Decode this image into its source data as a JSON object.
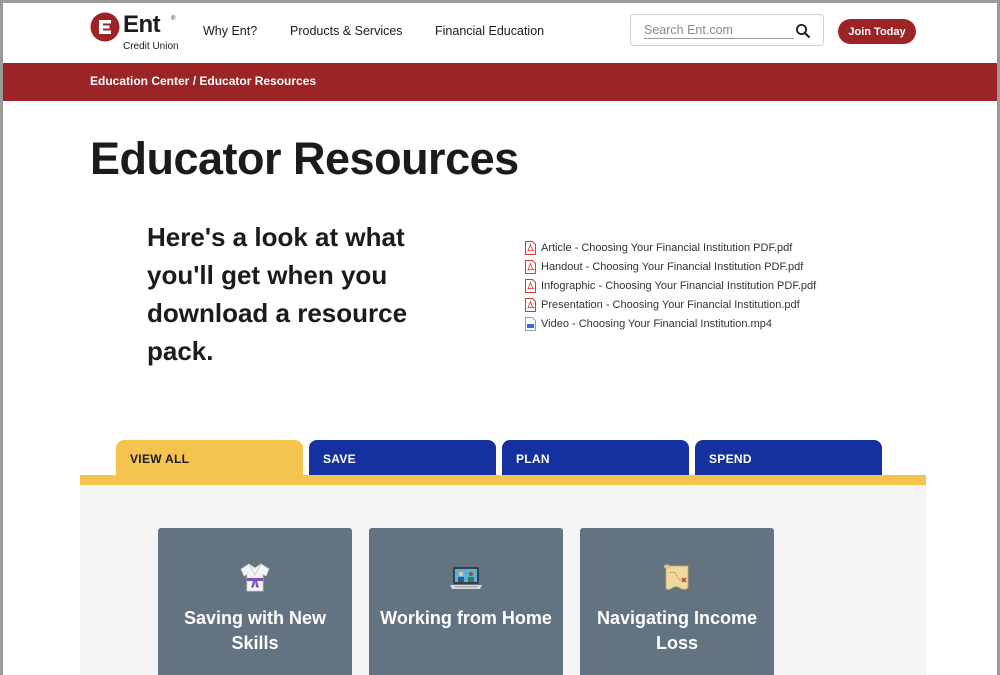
{
  "header": {
    "logo": {
      "word": "Ent",
      "tm": "®",
      "subtitle": "Credit Union"
    },
    "nav": [
      "Why Ent?",
      "Products & Services",
      "Financial Education"
    ],
    "search_placeholder": "Search Ent.com",
    "join_label": "Join Today"
  },
  "breadcrumb": {
    "section": "Education Center",
    "separator": " / ",
    "current": "Educator Resources"
  },
  "page_title": "Educator Resources",
  "lead": "Here's a look at what you'll get when you download a resource pack.",
  "files": [
    {
      "label": "Article - Choosing Your Financial Institution PDF.pdf",
      "icon": "pdf-file-icon"
    },
    {
      "label": "Handout - Choosing Your Financial Institution PDF.pdf",
      "icon": "pdf-file-icon"
    },
    {
      "label": "Infographic - Choosing Your Financial Institution PDF.pdf",
      "icon": "pdf-file-icon"
    },
    {
      "label": "Presentation - Choosing Your Financial Institution.pdf",
      "icon": "pdf-file-icon"
    },
    {
      "label": "Video - Choosing Your Financial Institution.mp4",
      "icon": "video-file-icon"
    }
  ],
  "tabs": [
    {
      "label": "VIEW ALL",
      "active": true
    },
    {
      "label": "SAVE",
      "active": false
    },
    {
      "label": "PLAN",
      "active": false
    },
    {
      "label": "SPEND",
      "active": false
    }
  ],
  "cards": [
    {
      "title": "Saving with New Skills",
      "icon": "karate-uniform-icon"
    },
    {
      "title": "Working from Home",
      "icon": "laptop-video-call-icon"
    },
    {
      "title": "Navigating Income Loss",
      "icon": "treasure-map-icon"
    }
  ],
  "colors": {
    "brand_red": "#9c2427",
    "tab_active": "#f5c44e",
    "tab_inactive": "#1531a0",
    "card_bg": "#647382",
    "panel_bg": "#f5f5f5"
  }
}
